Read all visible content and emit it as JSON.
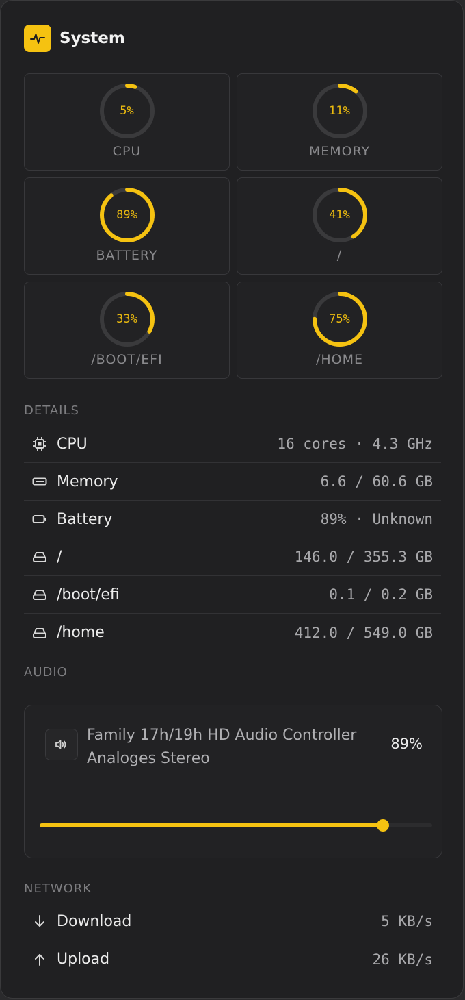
{
  "header": {
    "title": "System",
    "icon": "activity-icon"
  },
  "gauges": [
    {
      "label": "CPU",
      "value": "5%",
      "percent": 5
    },
    {
      "label": "MEMORY",
      "value": "11%",
      "percent": 11
    },
    {
      "label": "BATTERY",
      "value": "89%",
      "percent": 89
    },
    {
      "label": "/",
      "value": "41%",
      "percent": 41
    },
    {
      "label": "/BOOT/EFI",
      "value": "33%",
      "percent": 33
    },
    {
      "label": "/HOME",
      "value": "75%",
      "percent": 75
    }
  ],
  "details": {
    "title": "DETAILS",
    "rows": [
      {
        "icon": "cpu-chip-icon",
        "label": "CPU",
        "value": "16 cores · 4.3 GHz"
      },
      {
        "icon": "memory-icon",
        "label": "Memory",
        "value": "6.6 / 60.6 GB"
      },
      {
        "icon": "battery-icon",
        "label": "Battery",
        "value": "89% · Unknown"
      },
      {
        "icon": "drive-icon",
        "label": "/",
        "value": "146.0 / 355.3 GB"
      },
      {
        "icon": "drive-icon",
        "label": "/boot/efi",
        "value": "0.1 / 0.2 GB"
      },
      {
        "icon": "drive-icon",
        "label": "/home",
        "value": "412.0 / 549.0 GB"
      }
    ]
  },
  "audio": {
    "title": "AUDIO",
    "device_name": "Family 17h/19h HD Audio Controller Analoges Stereo",
    "volume_label": "89%",
    "volume": 89,
    "icon": "speaker-icon"
  },
  "network": {
    "title": "NETWORK",
    "rows": [
      {
        "icon": "arrow-down-icon",
        "label": "Download",
        "value": "5 KB/s"
      },
      {
        "icon": "arrow-up-icon",
        "label": "Upload",
        "value": "26 KB/s"
      }
    ]
  },
  "colors": {
    "accent": "#f5c211",
    "ring_track": "#3a3a3c",
    "background": "#202022"
  }
}
